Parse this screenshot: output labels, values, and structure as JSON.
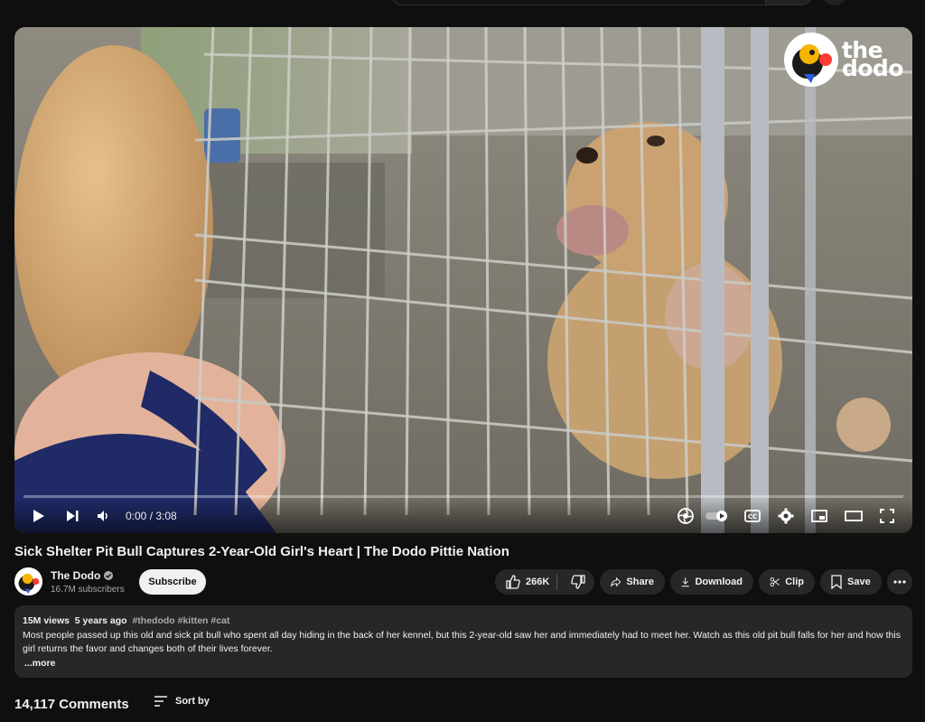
{
  "player": {
    "time_current": "0:00",
    "time_sep": " / ",
    "time_total": "3:08",
    "progress": 0,
    "watermark": "the\ndodo"
  },
  "video": {
    "title": "Sick Shelter Pit Bull Captures 2-Year-Old Girl's Heart | The Dodo Pittie Nation"
  },
  "channel": {
    "name": "The Dodo",
    "subscribers": "16.7M subscribers",
    "subscribe_label": "Subscribe"
  },
  "actions": {
    "like_count": "266K",
    "share_label": "Share",
    "download_label": "Download",
    "clip_label": "Clip",
    "save_label": "Save"
  },
  "description": {
    "views": "15M views",
    "age": "5 years ago",
    "tags": "#thedodo #kitten #cat",
    "text": "Most people passed up this old and sick pit bull who spent all day hiding in the back of her kennel, but this 2-year-old saw her and immediately had to meet her. Watch as this old pit bull falls for her and how this girl returns the favor and changes both of their lives forever.",
    "more_label": "...more"
  },
  "comments": {
    "count_label": "14,117 Comments",
    "sort_label": "Sort by"
  },
  "icons": {
    "play": "play-icon",
    "next": "next-icon",
    "volume": "volume-icon",
    "autoplay": "autoplay-toggle",
    "captions": "cc-icon",
    "settings": "gear-icon",
    "miniplayer": "miniplayer-icon",
    "theater": "theater-icon",
    "fullscreen": "fullscreen-icon"
  }
}
